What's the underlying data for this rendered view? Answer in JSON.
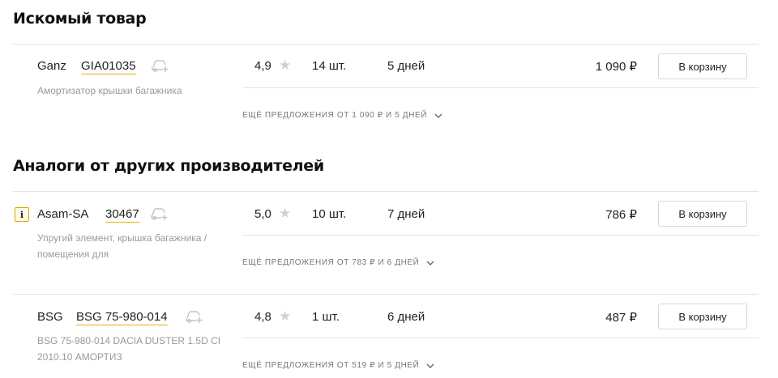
{
  "sections": {
    "main_title": "Искомый товар",
    "analogs_title": "Аналоги от других производителей"
  },
  "products": [
    {
      "brand": "Ganz",
      "article": "GIA01035",
      "description": "Амортизатор крышки багажника",
      "rating": "4,9",
      "quantity": "14 шт.",
      "delivery": "5 дней",
      "price": "1 090 ₽",
      "cart_label": "В корзину",
      "more_offers": "ЕЩЁ ПРЕДЛОЖЕНИЯ ОТ 1 090 ₽ И 5 ДНЕЙ"
    },
    {
      "info_badge": "i",
      "brand": "Asam-SA",
      "article": "30467",
      "description": "Упругий элемент, крышка багажника / помещения для",
      "rating": "5,0",
      "quantity": "10 шт.",
      "delivery": "7 дней",
      "price": "786 ₽",
      "cart_label": "В корзину",
      "more_offers": "ЕЩЁ ПРЕДЛОЖЕНИЯ ОТ 783 ₽ И 6 ДНЕЙ"
    },
    {
      "brand": "BSG",
      "article": "BSG 75-980-014",
      "description": "BSG 75-980-014 DACIA DUSTER 1.5D CI 2010.10 АМОРТИЗ",
      "rating": "4,8",
      "quantity": "1 шт.",
      "delivery": "6 дней",
      "price": "487 ₽",
      "cart_label": "В корзину",
      "more_offers": "ЕЩЁ ПРЕДЛОЖЕНИЯ ОТ 519 ₽ И 5 ДНЕЙ"
    }
  ],
  "icons": {
    "star": "star-icon",
    "car": "car-add-icon",
    "chevron": "chevron-down-icon",
    "info": "info-icon"
  },
  "colors": {
    "article_underline": "#e8b300",
    "info_border": "#e3a500",
    "star": "#d0d0d0",
    "muted_text": "#9a9a9a"
  }
}
